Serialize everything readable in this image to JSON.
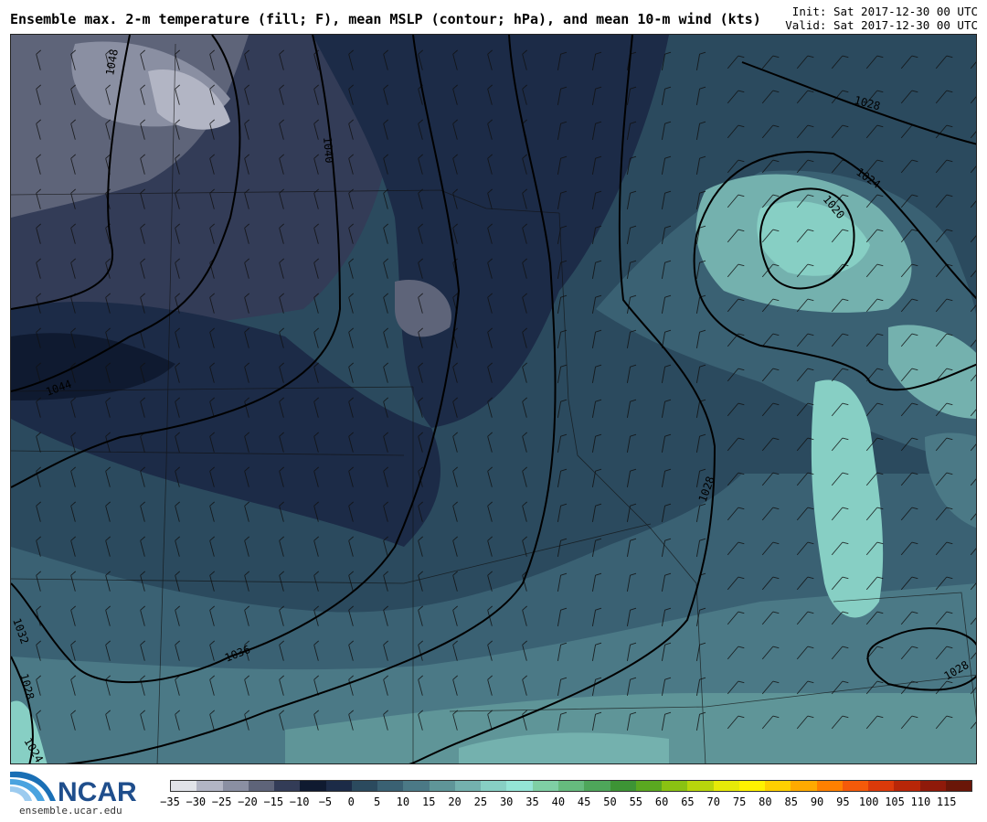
{
  "header": {
    "title": "Ensemble max. 2-m temperature (fill; F), mean MSLP (contour; hPa), and mean 10-m wind (kts)",
    "init": "Init: Sat 2017-12-30 00 UTC",
    "valid": "Valid: Sat 2017-12-30 00 UTC"
  },
  "map": {
    "contour_labels": [
      "1048",
      "1040",
      "1044",
      "1036",
      "1032",
      "1028",
      "1024",
      "1028",
      "1024",
      "1020",
      "1028",
      "1028",
      "1024"
    ]
  },
  "footer": {
    "logo_text": "NCAR",
    "site": "ensemble.ucar.edu"
  },
  "colorbar": {
    "labels": [
      "−35",
      "−30",
      "−25",
      "−20",
      "−15",
      "−10",
      "−5",
      "0",
      "5",
      "10",
      "15",
      "20",
      "25",
      "30",
      "35",
      "40",
      "45",
      "50",
      "55",
      "60",
      "65",
      "70",
      "75",
      "80",
      "85",
      "90",
      "95",
      "100",
      "105",
      "110",
      "115"
    ],
    "colors": [
      "#e1e3e8",
      "#b2b5c4",
      "#8a8fa2",
      "#5e6479",
      "#333c57",
      "#0f1a30",
      "#1c2b47",
      "#2b4a5e",
      "#3a6173",
      "#4b7986",
      "#5f9598",
      "#74b1ae",
      "#87cfc4",
      "#94e4d6",
      "#7fcfa4",
      "#66bb7e",
      "#4ea65a",
      "#3d9435",
      "#5aa820",
      "#8ac212",
      "#b8d60c",
      "#e6ea08",
      "#fff200",
      "#ffd000",
      "#ffaa00",
      "#ff8000",
      "#f45a0a",
      "#dc3a0a",
      "#b82608",
      "#8f1a0a",
      "#6a1608"
    ]
  }
}
